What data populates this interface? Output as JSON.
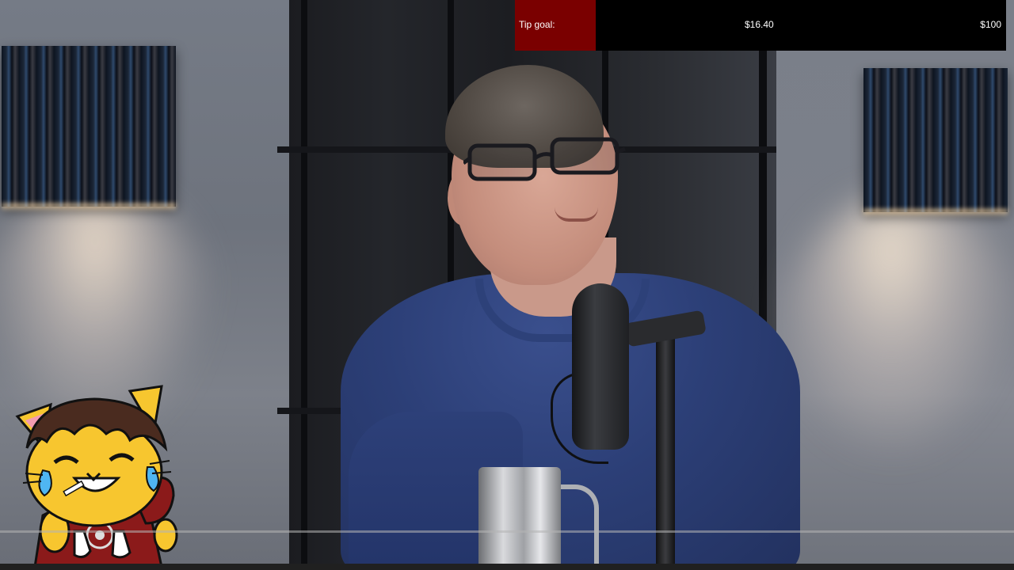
{
  "tip_goal": {
    "label": "Tip goal:",
    "current": "$16.40",
    "target": "$100",
    "progress_fraction": 0.164,
    "fill_color": "#7a0000"
  },
  "video": {
    "icons": {
      "mascot": "crying-laughing-cat-mascot-icon"
    }
  },
  "player": {
    "progress_fraction": 0.0
  }
}
